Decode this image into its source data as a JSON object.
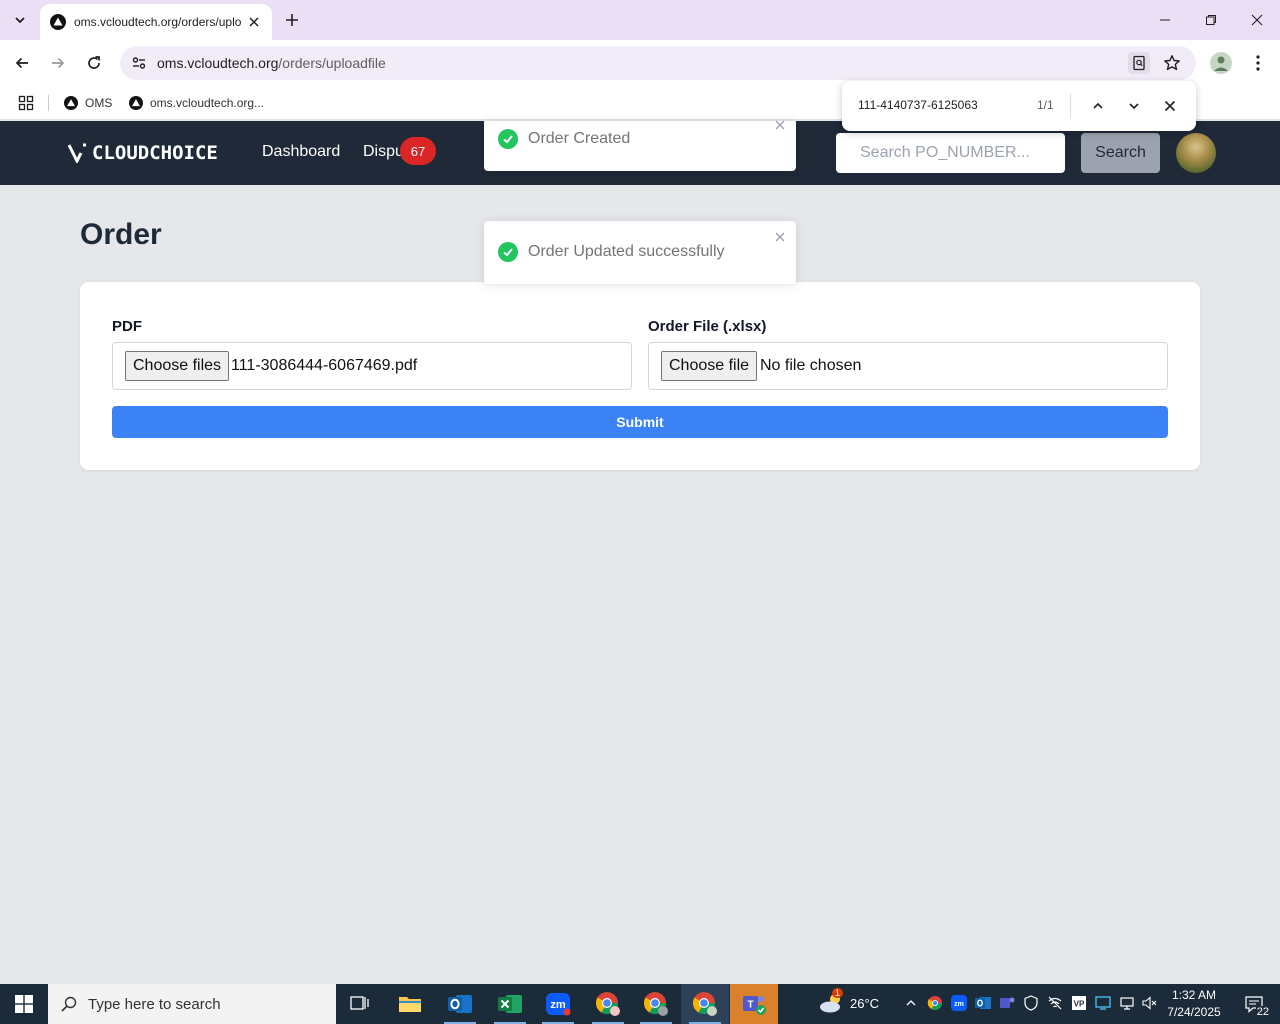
{
  "browser": {
    "tab_title": "oms.vcloudtech.org/orders/uplo",
    "url_host": "oms.vcloudtech.org",
    "url_path": "/orders/uploadfile",
    "bookmarks": [
      {
        "label": "OMS"
      },
      {
        "label": "oms.vcloudtech.org..."
      }
    ],
    "find": {
      "query": "111-4140737-6125063",
      "count": "1/1"
    }
  },
  "app": {
    "logo_text": "CLOUDCHOICE",
    "nav": {
      "dashboard": "Dashboard",
      "disputes": "Dispu",
      "badge": "67"
    },
    "search": {
      "placeholder": "Search PO_NUMBER...",
      "button": "Search"
    },
    "page_title": "Order",
    "form": {
      "pdf_label": "PDF",
      "pdf_button": "Choose files",
      "pdf_value": "111-3086444-6067469.pdf",
      "order_label": "Order File (.xlsx)",
      "order_button": "Choose file",
      "order_value": "No file chosen",
      "submit": "Submit"
    },
    "toasts": [
      {
        "message": "Order Created"
      },
      {
        "message": "Order Updated successfully"
      }
    ],
    "colors": {
      "nav_bg": "#1f2937",
      "submit": "#3b82f6",
      "badge": "#dc2626",
      "toast_success": "#22c55e"
    }
  },
  "taskbar": {
    "search_placeholder": "Type here to search",
    "weather": "26°C",
    "weather_badge": "1",
    "time": "1:32 AM",
    "date": "7/24/2025",
    "notifications": "22",
    "apps": [
      "task-view",
      "file-explorer",
      "outlook",
      "excel",
      "zoom",
      "chrome-profile-1",
      "chrome-profile-2",
      "chrome-profile-3",
      "teams"
    ]
  }
}
